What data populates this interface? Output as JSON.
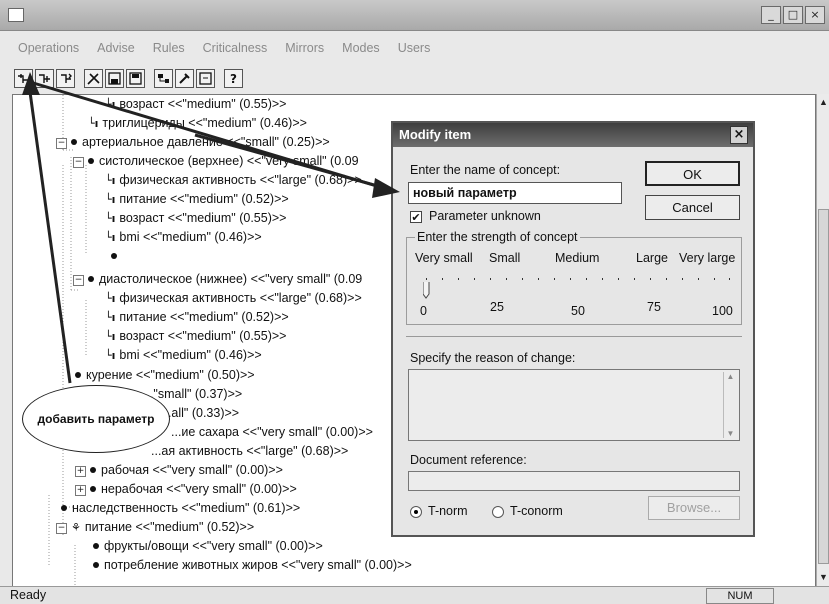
{
  "window": {
    "buttons": [
      "_",
      "□",
      "×"
    ]
  },
  "menu": [
    "Operations",
    "Advise",
    "Rules",
    "Criticalness",
    "Mirrors",
    "Modes",
    "Users"
  ],
  "toolbar": {
    "icons": [
      "add-child-icon",
      "add-sibling-icon",
      "move-node-icon",
      "tools-icon",
      "save-icon",
      "save-as-icon",
      "tree-view-icon",
      "edit-tool-icon",
      "window-icon",
      "help-icon"
    ]
  },
  "tree": {
    "rows": [
      "возраст <<\"medium\" (0.55)>>",
      "триглицериды <<\"medium\" (0.46)>>",
      "артериальное давление <<\"small\" (0.25)>>",
      "систолическое (верхнее) <<\"very small\" (0.09",
      "физическая активность <<\"large\" (0.68)>>",
      "питание <<\"medium\" (0.52)>>",
      "возраст <<\"medium\" (0.55)>>",
      "bmi <<\"medium\" (0.46)>>",
      "",
      "диастолическое (нижнее) <<\"very small\" (0.09",
      "физическая активность <<\"large\" (0.68)>>",
      "питание <<\"medium\" (0.52)>>",
      "возраст <<\"medium\" (0.55)>>",
      "bmi <<\"medium\" (0.46)>>",
      "курение <<\"medium\" (0.50)>>",
      "...\"small\" (0.37)>>",
      "...all\" (0.33)>>",
      "...ие сахара <<\"very small\" (0.00)>>",
      "...ая активность <<\"large\" (0.68)>>",
      "рабочая <<\"very small\" (0.00)>>",
      "нерабочая <<\"very small\" (0.00)>>",
      "наследственность <<\"medium\" (0.61)>>",
      "питание <<\"medium\" (0.52)>>",
      "фрукты/овощи <<\"very small\" (0.00)>>",
      "потребление животных жиров <<\"very small\" (0.00)>>"
    ]
  },
  "status": {
    "text": "Ready",
    "num": "NUM"
  },
  "dialog": {
    "title": "Modify item",
    "close": "×",
    "name_label": "Enter the name of concept:",
    "name_value": "новый параметр",
    "ok": "OK",
    "cancel": "Cancel",
    "param_unknown": "Parameter unknown",
    "param_unknown_checked": true,
    "strength_group": "Enter the strength of concept",
    "scale_labels": [
      "Very small",
      "Small",
      "Medium",
      "Large",
      "Very large"
    ],
    "scale_numbers": [
      "0",
      "25",
      "50",
      "75",
      "100"
    ],
    "strength_value": 0,
    "reason_label": "Specify the reason of change:",
    "reason_text": "",
    "docref_label": "Document reference:",
    "docref_value": "",
    "tnorm": "T-norm",
    "tconorm": "T-conorm",
    "selected_norm": "T-norm",
    "browse": "Browse..."
  },
  "callout": {
    "text": "добавить параметр"
  }
}
